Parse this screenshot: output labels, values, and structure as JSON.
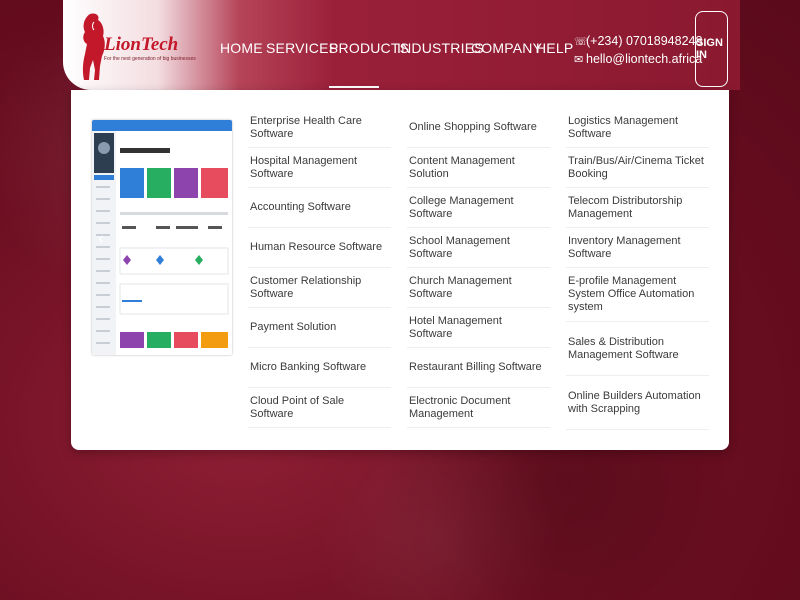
{
  "brand": {
    "name": "LionTech",
    "tagline": "For the next generation of big businesses"
  },
  "nav": {
    "items": [
      {
        "label": "HOME"
      },
      {
        "label": "SERVICES"
      },
      {
        "label": "PRODUCTS",
        "active": true
      },
      {
        "label": "INDUSTRIES"
      },
      {
        "label": "COMPANY"
      },
      {
        "label": "HELP"
      }
    ]
  },
  "contact": {
    "phone": "(+234) 07018948248",
    "email": "hello@liontech.africa"
  },
  "auth": {
    "signin_label": "SIGN IN"
  },
  "products": {
    "column1": [
      "Enterprise Health Care Software",
      "Hospital Management Software",
      "Accounting Software",
      "Human Resource Software",
      "Customer Relationship Software",
      "Payment Solution",
      "Micro Banking Software",
      "Cloud Point of Sale Software"
    ],
    "column2": [
      "Online Shopping Software",
      "Content Management Solution",
      "College Management Software",
      "School Management Software",
      "Church Management Software",
      "Hotel Management Software",
      "Restaurant Billing Software",
      "Electronic Document Management"
    ],
    "column3": [
      "Logistics Management Software",
      "Train/Bus/Air/Cinema Ticket Booking",
      "Telecom Distributorship Management",
      "Inventory Management Software",
      "E-profile Management System Office Automation system",
      "Sales & Distribution Management Software",
      "Online Builders Automation with Scrapping"
    ]
  },
  "colors": {
    "brand_red": "#c3172a",
    "background": "#6e0f22",
    "header_accent": "#9a2039"
  }
}
